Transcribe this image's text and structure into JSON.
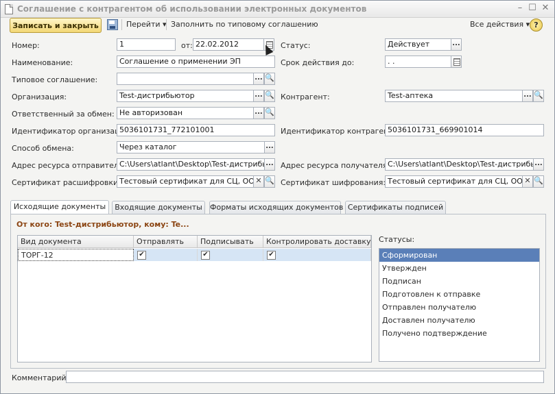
{
  "window": {
    "title": "Соглашение с контрагентом об использовании электронных документов",
    "minimize": "–",
    "maximize": "☐",
    "close": "✕"
  },
  "toolbar": {
    "save_close": "Записать и закрыть",
    "goto": "Перейти",
    "fill_typical": "Заполнить по типовому соглашению",
    "all_actions": "Все действия",
    "help": "?"
  },
  "form": {
    "number_label": "Номер:",
    "number_value": "1",
    "date_label": "от:",
    "date_value": "22.02.2012",
    "status_label": "Статус:",
    "status_value": "Действует",
    "name_label": "Наименование:",
    "name_value": "Соглашение о применении ЭП",
    "valid_until_label": "Срок действия до:",
    "valid_until_value": " .  .",
    "typical_label": "Типовое соглашение:",
    "typical_value": "",
    "org_label": "Организация:",
    "org_value": "Test-дистрибьютор",
    "counterparty_label": "Контрагент:",
    "counterparty_value": "Test-аптека",
    "responsible_label": "Ответственный за обмен:",
    "responsible_value": "Не авторизован",
    "org_id_label": "Идентификатор организации:",
    "org_id_value": "5036101731_772101001",
    "cp_id_label": "Идентификатор контрагента:",
    "cp_id_value": "5036101731_669901014",
    "exchange_label": "Способ обмена:",
    "exchange_value": "Через каталог",
    "sender_res_label": "Адрес ресурса отправителя:",
    "sender_res_value": "C:\\Users\\atlant\\Desktop\\Test-дистрибьютор",
    "recipient_res_label": "Адрес ресурса получателя:",
    "recipient_res_value": "C:\\Users\\atlant\\Desktop\\Test-дистрибьютор",
    "decrypt_cert_label": "Сертификат расшифровки:",
    "decrypt_cert_value": "Тестовый сертификат для СЦ, ООО Ор",
    "encrypt_cert_label": "Сертификат шифрования:",
    "encrypt_cert_value": "Тестовый сертификат для СЦ, ООО Ор"
  },
  "tabs": [
    {
      "label": "Исходящие документы"
    },
    {
      "label": "Входящие документы"
    },
    {
      "label": "Форматы исходящих документов"
    },
    {
      "label": "Сертификаты подписей"
    }
  ],
  "outgoing": {
    "from_line": "От кого: Test-дистрибьютор, кому: Te...",
    "columns": [
      "Вид документа",
      "Отправлять",
      "Подписывать",
      "Контролировать доставку"
    ],
    "rows": [
      {
        "doc": "ТОРГ-12",
        "send": true,
        "sign": true,
        "control": true
      }
    ],
    "statuses_label": "Статусы:",
    "statuses": [
      "Сформирован",
      "Утвержден",
      "Подписан",
      "Подготовлен к отправке",
      "Отправлен получателю",
      "Доставлен получателю",
      "Получено подтверждение"
    ]
  },
  "comment": {
    "label": "Комментарий:",
    "value": ""
  },
  "icons": {
    "select": "...",
    "search": "🔍",
    "clear": "✕",
    "check": "✔"
  }
}
